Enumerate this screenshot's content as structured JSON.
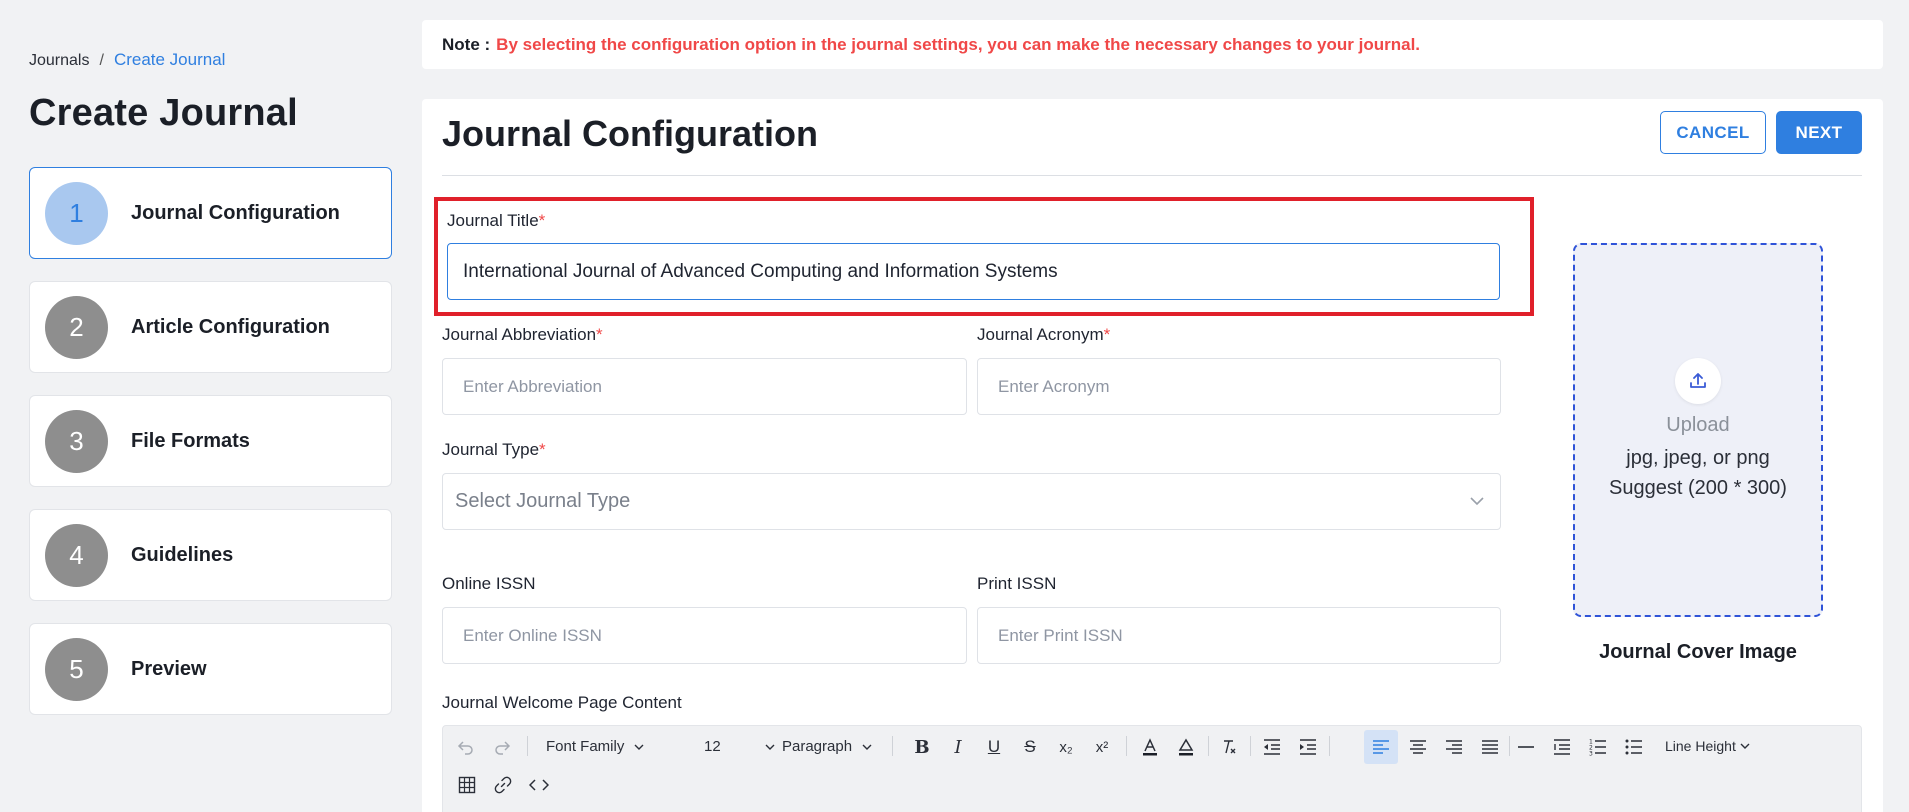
{
  "breadcrumb": {
    "root": "Journals",
    "separator": "/",
    "current": "Create Journal"
  },
  "page_title": "Create Journal",
  "steps": [
    {
      "number": "1",
      "label": "Journal Configuration",
      "active": true
    },
    {
      "number": "2",
      "label": "Article Configuration",
      "active": false
    },
    {
      "number": "3",
      "label": "File Formats",
      "active": false
    },
    {
      "number": "4",
      "label": "Guidelines",
      "active": false
    },
    {
      "number": "5",
      "label": "Preview",
      "active": false
    }
  ],
  "note": {
    "label": "Note :",
    "text": "By selecting the configuration option in the journal settings, you can make the necessary changes to your journal."
  },
  "card": {
    "title": "Journal Configuration",
    "cancel_label": "CANCEL",
    "next_label": "NEXT"
  },
  "form": {
    "title_label": "Journal Title",
    "title_value": "International Journal of Advanced Computing and Information Systems",
    "abbreviation_label": "Journal Abbreviation",
    "abbreviation_placeholder": "Enter Abbreviation",
    "acronym_label": "Journal Acronym",
    "acronym_placeholder": "Enter Acronym",
    "type_label": "Journal Type",
    "type_placeholder": "Select Journal Type",
    "online_issn_label": "Online ISSN",
    "online_issn_placeholder": "Enter Online ISSN",
    "print_issn_label": "Print ISSN",
    "print_issn_placeholder": "Enter Print ISSN",
    "welcome_label": "Journal Welcome Page Content",
    "required_mark": "*"
  },
  "upload": {
    "title": "Upload",
    "formats": "jpg, jpeg, or png",
    "suggest": "Suggest (200 * 300)",
    "caption": "Journal Cover Image"
  },
  "toolbar": {
    "font_family": "Font Family",
    "font_size": "12",
    "block_format": "Paragraph",
    "line_height": "Line Height",
    "subscript_icon": "x₂",
    "superscript_icon": "x²"
  },
  "colors": {
    "accent": "#2f7fe0",
    "note_red": "#f04848",
    "highlight_red": "#e0202a",
    "upload_border": "#2f53d8"
  }
}
